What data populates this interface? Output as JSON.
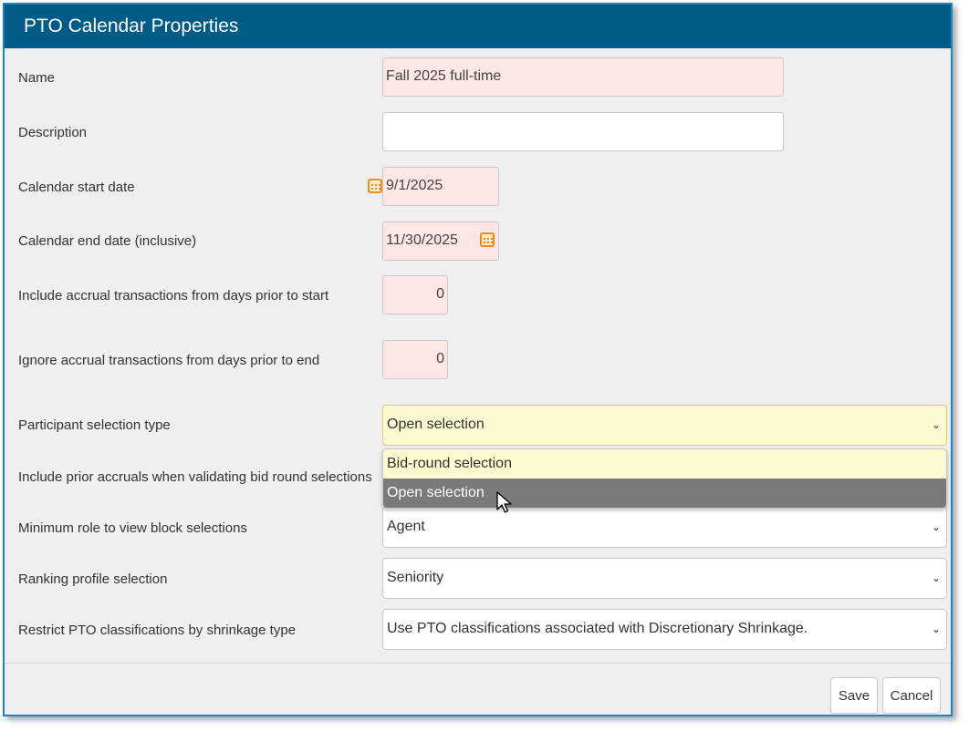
{
  "dialog": {
    "title": "PTO Calendar Properties"
  },
  "form": {
    "name": {
      "label": "Name",
      "value": "Fall 2025 full-time"
    },
    "description": {
      "label": "Description",
      "value": ""
    },
    "start_date": {
      "label": "Calendar start date",
      "value": "9/1/2025"
    },
    "end_date": {
      "label": "Calendar end date (inclusive)",
      "value": "11/30/2025"
    },
    "include_prior": {
      "label": "Include accrual transactions from days prior to start",
      "value": "0"
    },
    "ignore_prior": {
      "label": "Ignore accrual transactions from days prior to end",
      "value": "0"
    },
    "participant_type": {
      "label": "Participant selection type",
      "value": "Open selection",
      "options": [
        "Bid-round selection",
        "Open selection"
      ]
    },
    "include_prior_accruals": {
      "label": "Include prior accruals when validating bid round selections"
    },
    "min_role": {
      "label": "Minimum role to view block selections",
      "value": "Agent"
    },
    "ranking_profile": {
      "label": "Ranking profile selection",
      "value": "Seniority"
    },
    "restrict_pto": {
      "label": "Restrict PTO classifications by shrinkage type",
      "value": "Use PTO classifications associated with Discretionary Shrinkage."
    }
  },
  "buttons": {
    "save": "Save",
    "cancel": "Cancel"
  },
  "colors": {
    "title_bar": "#005b86",
    "required_field": "#fde6e6",
    "focused_select": "#fbfad0",
    "calendar_icon": "#f08c1a",
    "option_hover": "#7a7a7a"
  },
  "icons": {
    "calendar": "calendar-icon",
    "chevron": "chevron-down-icon",
    "cursor": "mouse-pointer-icon"
  }
}
